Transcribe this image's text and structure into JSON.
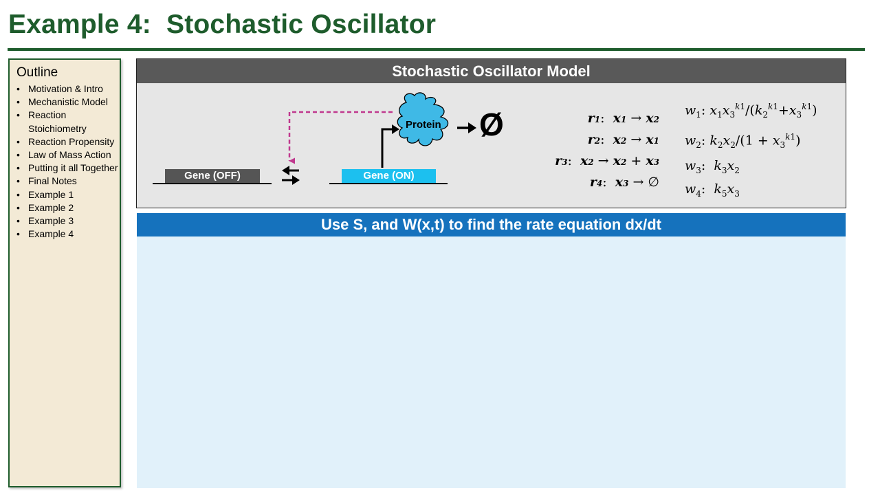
{
  "title": "Example 4:  Stochastic Oscillator",
  "colors": {
    "title_green": "#1e5c2c",
    "outline_bg": "#f3ead6",
    "model_header": "#595959",
    "rate_header": "#1572bd",
    "rate_bg": "#e1f1fa",
    "gene_on": "#1cc0ef",
    "protein": "#3fb9e6",
    "feedback_arrow": "#c0398e"
  },
  "outline": {
    "heading": "Outline",
    "items": [
      "Motivation & Intro",
      "Mechanistic Model",
      "Reaction Stoichiometry",
      "Reaction Propensity",
      "Law of Mass Action",
      "Putting it all Together",
      "Final Notes",
      "Example 1",
      "Example 2",
      "Example 3",
      "Example 4"
    ]
  },
  "model": {
    "header": "Stochastic Oscillator Model",
    "gene_off": "Gene (OFF)",
    "gene_on": "Gene (ON)",
    "protein": "Protein",
    "degradation_symbol": "Ø",
    "reactions": [
      "r1:  x1 → x2",
      "r2:  x2 → x1",
      "r3:  x2 → x2 + x3",
      "r4:  x3 → ∅"
    ],
    "propensities": [
      "w1: x1x3^k1/(k2^k1+x3^k1)",
      "w2: k2x2/(1 + x3^k1)",
      "w3:  k3x2",
      "w4:  k5x3"
    ]
  },
  "rate": {
    "header": "Use S, and W(x,t) to find the rate equation dx/dt"
  }
}
